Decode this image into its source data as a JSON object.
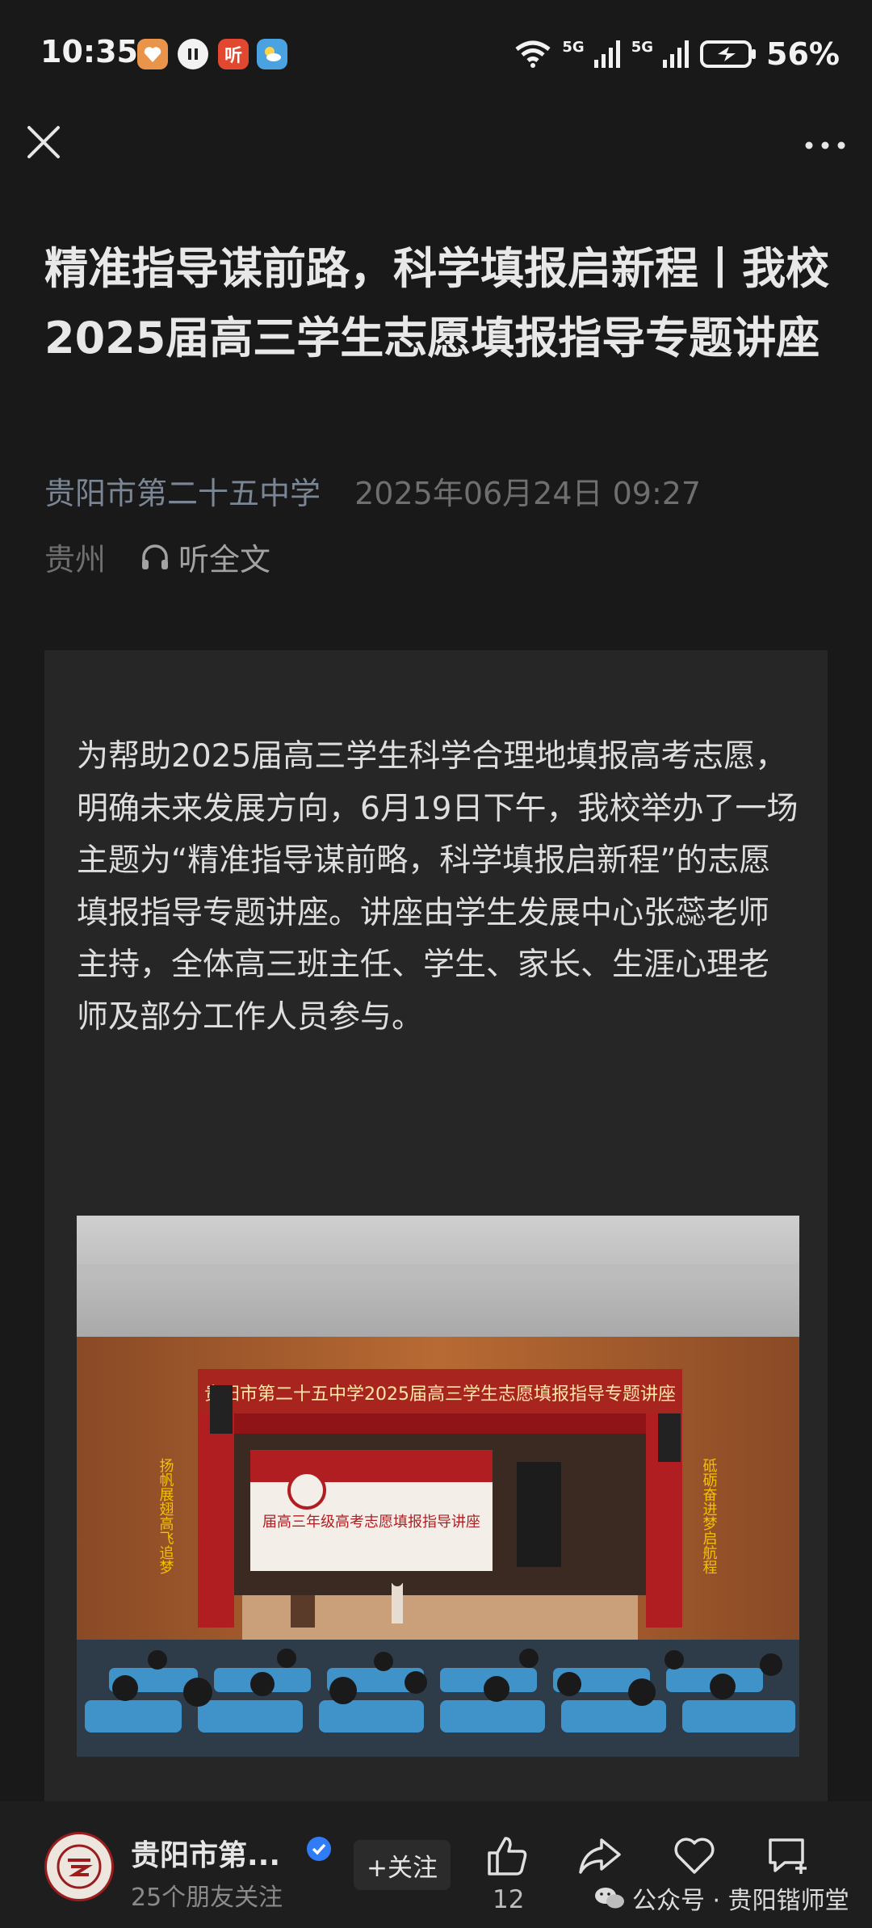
{
  "status_bar": {
    "time": "10:35",
    "app_icon_3_text": "听",
    "network_1": "5G",
    "network_2": "5G",
    "battery": "56%"
  },
  "article": {
    "title": "精准指导谋前路，科学填报启新程丨我校2025届高三学生志愿填报指导专题讲座",
    "author": "贵阳市第二十五中学",
    "datetime": "2025年06月24日 09:27",
    "location": "贵州",
    "listen_label": "听全文",
    "paragraph": "为帮助2025届高三学生科学合理地填报高考志愿，明确未来发展方向，6月19日下午，我校举办了一场主题为“精准指导谋前略，科学填报启新程”的志愿填报指导专题讲座。讲座由学生发展中心张蕊老师主持，全体高三班主任、学生、家长、生涯心理老师及部分工作人员参与。"
  },
  "photo": {
    "banner_text": "贵阳市第二十五中学2025届高三学生志愿填报指导专题讲座",
    "screen_text": "届高三年级高考志愿填报指导讲座",
    "left_couplet": "扬帆展翅高飞追梦",
    "right_couplet": "砥砺奋进梦启航程"
  },
  "bottom_bar": {
    "account_name": "贵阳市第...",
    "friends_follow": "25个朋友关注",
    "follow_label": "+关注",
    "like_count": "12",
    "watermark": "公众号 · 贵阳锴师堂"
  },
  "colors": {
    "background": "#191919",
    "card": "#262626",
    "verified": "#2f7cf6",
    "curtain": "#b01e22"
  }
}
